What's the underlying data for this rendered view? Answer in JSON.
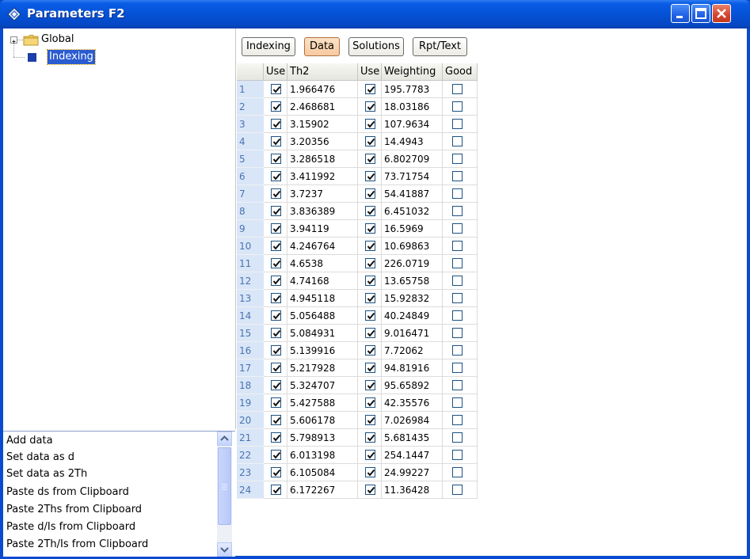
{
  "window": {
    "title": "Parameters F2"
  },
  "tree": {
    "items": [
      {
        "label": "Global"
      },
      {
        "label": "Indexing"
      }
    ]
  },
  "commands": [
    "Add data",
    "Set data as d",
    "Set data as 2Th",
    "Paste ds from Clipboard",
    "Paste 2Ths from Clipboard",
    "Paste d/Is from Clipboard",
    "Paste 2Th/Is from Clipboard"
  ],
  "tabs": [
    {
      "label": "Indexing",
      "active": false
    },
    {
      "label": "Data",
      "active": true
    },
    {
      "label": "Solutions",
      "active": false
    },
    {
      "label": "Rpt/Text",
      "active": false
    }
  ],
  "table": {
    "headers": [
      "",
      "Use",
      "Th2",
      "Use",
      "Weighting",
      "Good"
    ],
    "rows": [
      {
        "n": "1",
        "use1": true,
        "th2": "1.966476",
        "use2": true,
        "weighting": "195.7783",
        "good": false
      },
      {
        "n": "2",
        "use1": true,
        "th2": "2.468681",
        "use2": true,
        "weighting": "18.03186",
        "good": false
      },
      {
        "n": "3",
        "use1": true,
        "th2": "3.15902",
        "use2": true,
        "weighting": "107.9634",
        "good": false
      },
      {
        "n": "4",
        "use1": true,
        "th2": "3.20356",
        "use2": true,
        "weighting": "14.4943",
        "good": false
      },
      {
        "n": "5",
        "use1": true,
        "th2": "3.286518",
        "use2": true,
        "weighting": "6.802709",
        "good": false
      },
      {
        "n": "6",
        "use1": true,
        "th2": "3.411992",
        "use2": true,
        "weighting": "73.71754",
        "good": false
      },
      {
        "n": "7",
        "use1": true,
        "th2": "3.7237",
        "use2": true,
        "weighting": "54.41887",
        "good": false
      },
      {
        "n": "8",
        "use1": true,
        "th2": "3.836389",
        "use2": true,
        "weighting": "6.451032",
        "good": false
      },
      {
        "n": "9",
        "use1": true,
        "th2": "3.94119",
        "use2": true,
        "weighting": "16.5969",
        "good": false
      },
      {
        "n": "10",
        "use1": true,
        "th2": "4.246764",
        "use2": true,
        "weighting": "10.69863",
        "good": false
      },
      {
        "n": "11",
        "use1": true,
        "th2": "4.6538",
        "use2": true,
        "weighting": "226.0719",
        "good": false
      },
      {
        "n": "12",
        "use1": true,
        "th2": "4.74168",
        "use2": true,
        "weighting": "13.65758",
        "good": false
      },
      {
        "n": "13",
        "use1": true,
        "th2": "4.945118",
        "use2": true,
        "weighting": "15.92832",
        "good": false
      },
      {
        "n": "14",
        "use1": true,
        "th2": "5.056488",
        "use2": true,
        "weighting": "40.24849",
        "good": false
      },
      {
        "n": "15",
        "use1": true,
        "th2": "5.084931",
        "use2": true,
        "weighting": "9.016471",
        "good": false
      },
      {
        "n": "16",
        "use1": true,
        "th2": "5.139916",
        "use2": true,
        "weighting": "7.72062",
        "good": false
      },
      {
        "n": "17",
        "use1": true,
        "th2": "5.217928",
        "use2": true,
        "weighting": "94.81916",
        "good": false
      },
      {
        "n": "18",
        "use1": true,
        "th2": "5.324707",
        "use2": true,
        "weighting": "95.65892",
        "good": false
      },
      {
        "n": "19",
        "use1": true,
        "th2": "5.427588",
        "use2": true,
        "weighting": "42.35576",
        "good": false
      },
      {
        "n": "20",
        "use1": true,
        "th2": "5.606178",
        "use2": true,
        "weighting": "7.026984",
        "good": false
      },
      {
        "n": "21",
        "use1": true,
        "th2": "5.798913",
        "use2": true,
        "weighting": "5.681435",
        "good": false
      },
      {
        "n": "22",
        "use1": true,
        "th2": "6.013198",
        "use2": true,
        "weighting": "254.1447",
        "good": false
      },
      {
        "n": "23",
        "use1": true,
        "th2": "6.105084",
        "use2": true,
        "weighting": "24.99227",
        "good": false
      },
      {
        "n": "24",
        "use1": true,
        "th2": "6.172267",
        "use2": true,
        "weighting": "11.36428",
        "good": false
      }
    ]
  },
  "icons": {
    "app": "diamond-app-icon",
    "minimize": "minimize-icon",
    "maximize": "maximize-icon",
    "close": "close-icon",
    "folder": "folder-icon",
    "scroll_up": "scroll-up-icon",
    "scroll_down": "scroll-down-icon"
  },
  "colors": {
    "titlebar": "#0552d6",
    "selection": "#2a5bd0",
    "active_tab": "#f7c9a0",
    "row_header": "#d9e6f8"
  }
}
